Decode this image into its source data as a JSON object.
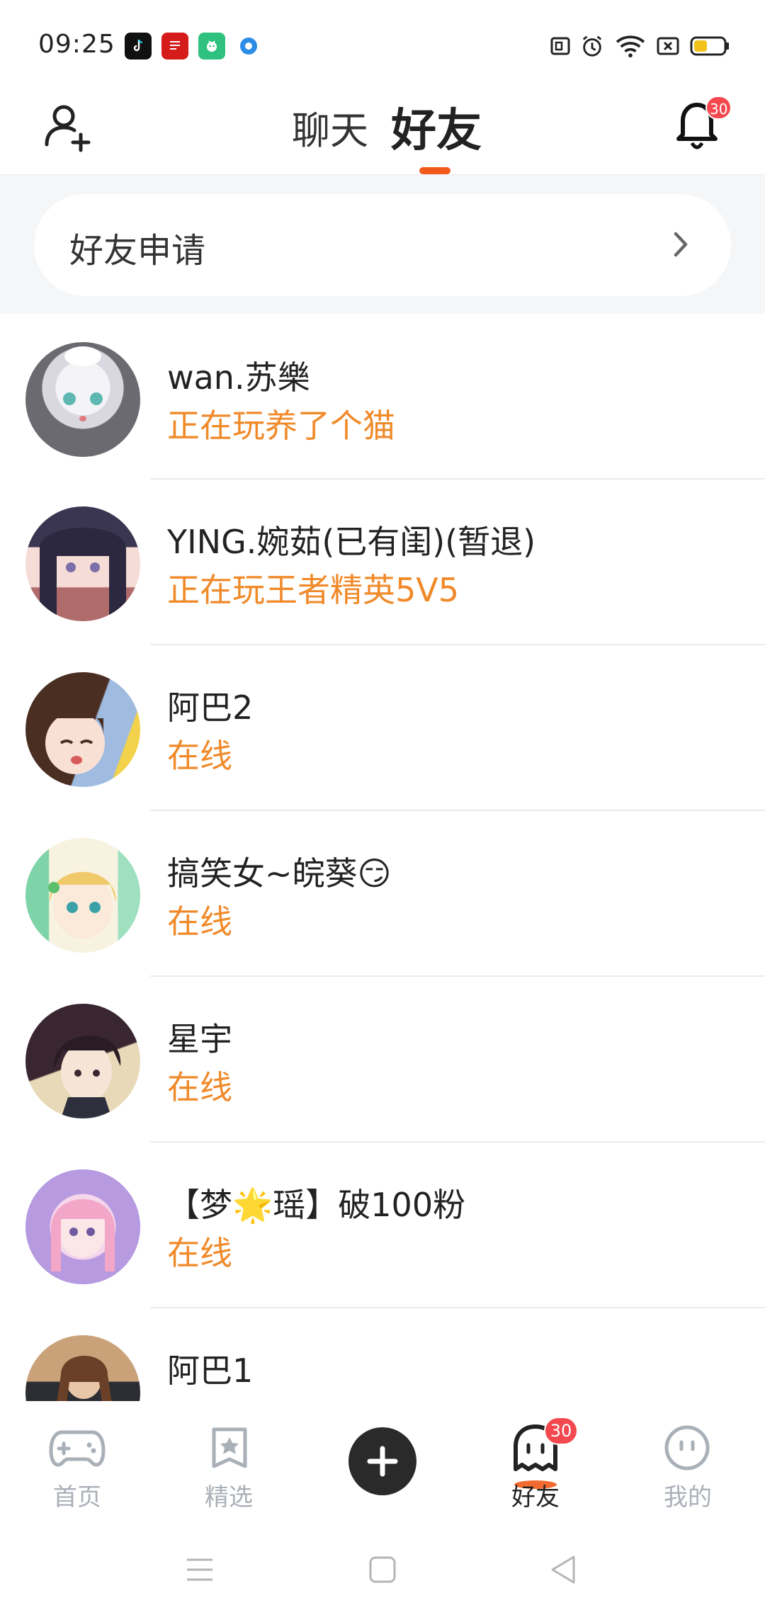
{
  "status_bar": {
    "time": "09:25",
    "battery_level": 0.45,
    "apps": [
      "tiktok-icon",
      "news-icon",
      "wechat-game-icon",
      "browser-icon"
    ],
    "icons": [
      "nfc-icon",
      "alarm-icon",
      "wifi-icon",
      "sim-off-icon",
      "battery-icon"
    ]
  },
  "header": {
    "tabs": [
      {
        "label": "聊天",
        "active": false
      },
      {
        "label": "好友",
        "active": true
      }
    ],
    "notification_count": "30",
    "accent_color": "#f25a1b"
  },
  "friend_request": {
    "label": "好友申请"
  },
  "friends": [
    {
      "name": "wan.苏樂",
      "status": "正在玩养了个猫",
      "avatar": "anime-girl-white-hair"
    },
    {
      "name": "YING.婉茹(已有闺)(暂退)",
      "status": "正在玩王者精英5V5",
      "avatar": "anime-girl-dark-hair"
    },
    {
      "name": "阿巴2",
      "status": "在线",
      "avatar": "anime-girl-bob-hair"
    },
    {
      "name": "搞笑女~皖葵",
      "name_emoji": "😏",
      "status": "在线",
      "avatar": "anime-girl-blonde"
    },
    {
      "name": "星宇",
      "status": "在线",
      "avatar": "anime-boy-dark-hair"
    },
    {
      "name": "【梦",
      "name_emoji": "🌟",
      "name_suffix": "瑶】破100粉",
      "status": "在线",
      "avatar": "anime-girl-pink-hair"
    },
    {
      "name": "阿巴1",
      "status": "",
      "avatar": "photo-girl"
    }
  ],
  "bottom_nav": {
    "items": [
      {
        "label": "首页",
        "icon": "gamepad-icon",
        "active": false
      },
      {
        "label": "精选",
        "icon": "star-bookmark-icon",
        "active": false
      },
      {
        "label": "",
        "icon": "plus-icon",
        "active": false
      },
      {
        "label": "好友",
        "icon": "ghost-icon",
        "active": true,
        "badge": "30"
      },
      {
        "label": "我的",
        "icon": "face-icon",
        "active": false
      }
    ]
  }
}
